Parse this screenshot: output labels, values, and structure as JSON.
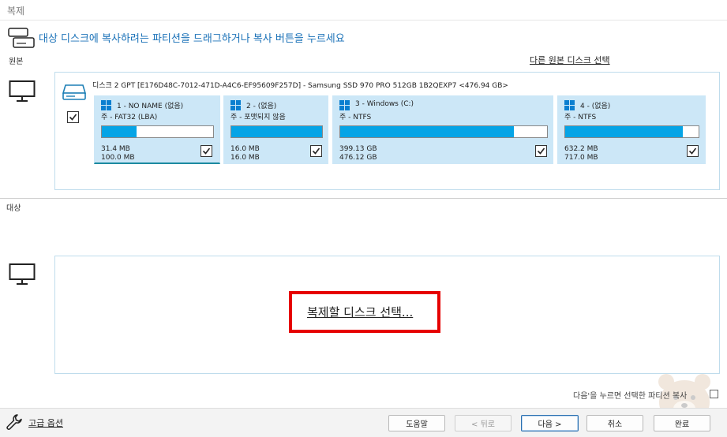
{
  "window": {
    "title": "복제"
  },
  "instruction": "대상 디스크에 복사하려는 파티션을 드래그하거나 복사 버튼을 누르세요",
  "source": {
    "label": "원본",
    "select_other_link": "다른 원본 디스크 선택",
    "disk_title": "디스크 2 GPT [E176D48C-7012-471D-A4C6-EF95609F257D] - Samsung SSD 970 PRO 512GB 1B2QEXP7  <476.94 GB>",
    "disk_checked": true,
    "partitions": [
      {
        "name": "1 - NO NAME (없음)",
        "fs": "주 - FAT32 (LBA)",
        "used": "31.4 MB",
        "total": "100.0 MB",
        "fill": 0.31,
        "checked": true
      },
      {
        "name": "2 - (없음)",
        "fs": "주 - 포맷되지 않음",
        "used": "16.0 MB",
        "total": "16.0 MB",
        "fill": 1.0,
        "checked": true
      },
      {
        "name": "3 - Windows (C:)",
        "fs": "주 - NTFS",
        "used": "399.13 GB",
        "total": "476.12 GB",
        "fill": 0.84,
        "checked": true
      },
      {
        "name": "4 - (없음)",
        "fs": "주 - NTFS",
        "used": "632.2 MB",
        "total": "717.0 MB",
        "fill": 0.88,
        "checked": true
      }
    ]
  },
  "target": {
    "label": "대상",
    "select_disk_link": "복제할 디스크 선택..."
  },
  "note": "다음'을 누르면 선택한 파티션 복사",
  "footer": {
    "advanced_options": "고급 옵션",
    "help": "도움말",
    "back": "< 뒤로",
    "next": "다음 >",
    "cancel": "취소",
    "finish": "완료"
  },
  "colors": {
    "accent": "#1b72b8",
    "partition_bg": "#cce7f7",
    "bar_fill": "#05a4e6",
    "highlight": "#e60000"
  }
}
